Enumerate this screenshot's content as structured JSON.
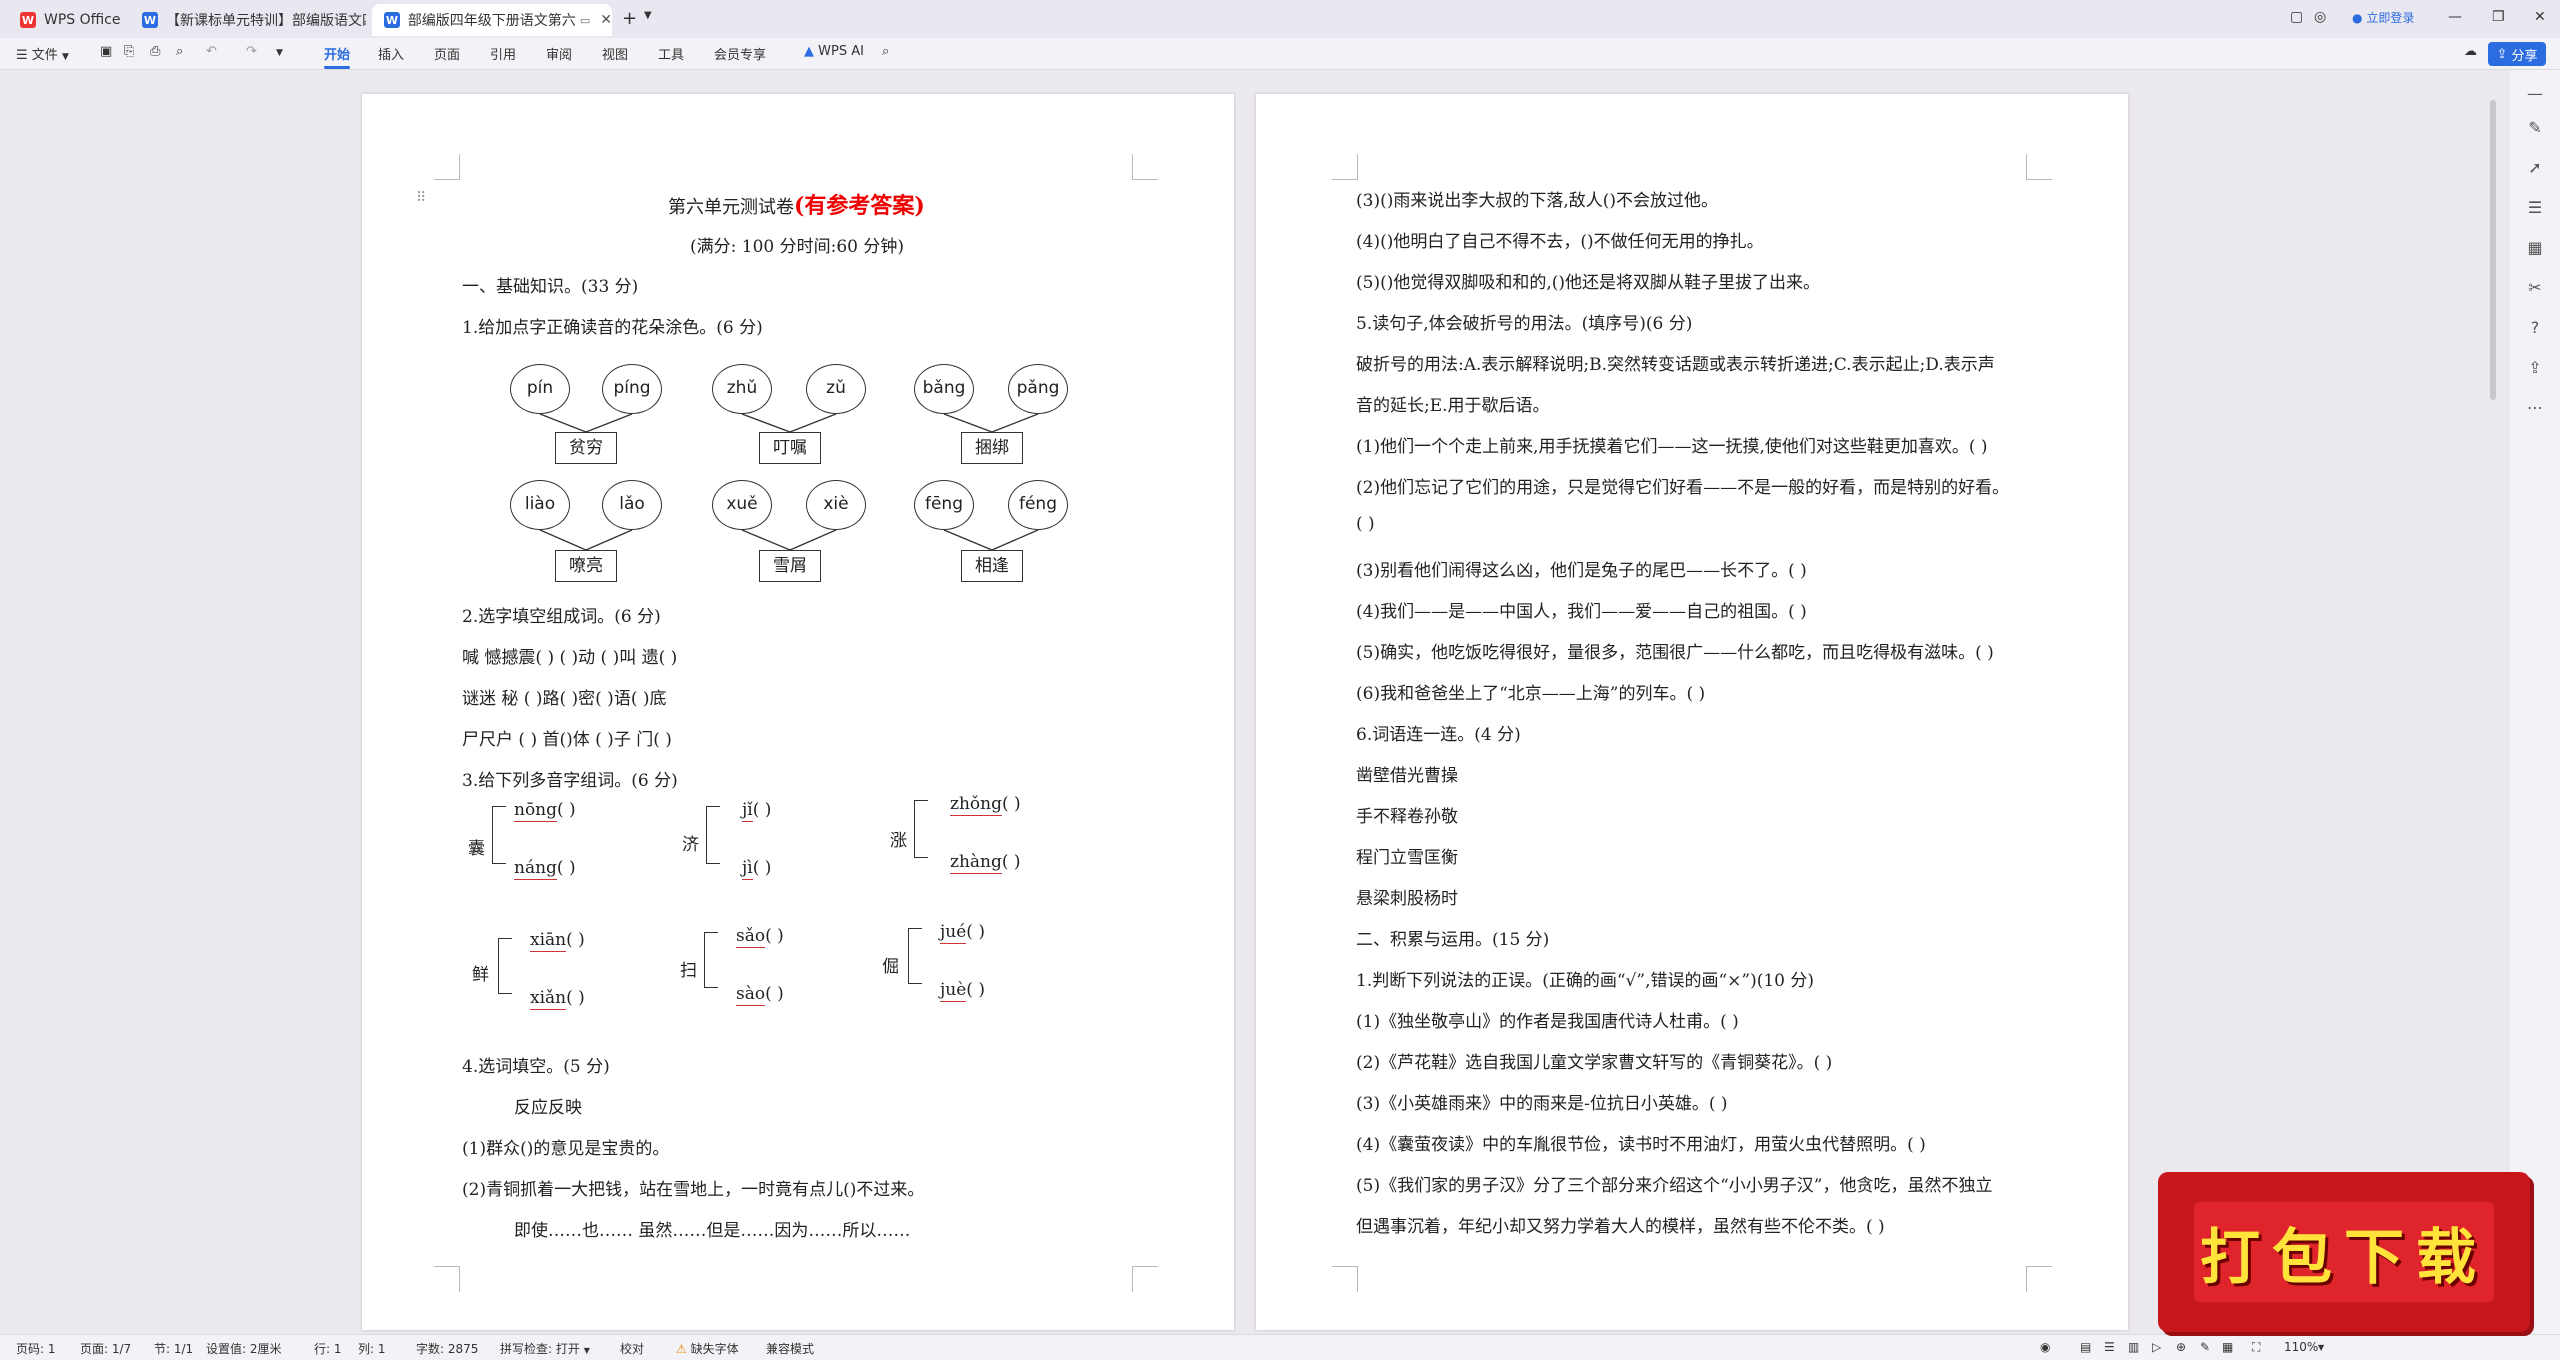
{
  "tabs": [
    {
      "label": "WPS Office",
      "icon": "wps-logo-icon"
    },
    {
      "label": "【新课标单元特训】部编版语文四年",
      "icon": "word-doc-icon"
    },
    {
      "label": "部编版四年级下册语文第六单",
      "icon": "word-doc-icon"
    }
  ],
  "window": {
    "login": "立即登录"
  },
  "menu": {
    "file": "文件",
    "tabs": [
      "开始",
      "插入",
      "页面",
      "引用",
      "审阅",
      "视图",
      "工具",
      "会员专享"
    ],
    "ai": "WPS AI",
    "share": "分享"
  },
  "page1": {
    "title_a": "第六单元测试卷",
    "title_b": "(有参考答案)",
    "subtitle": "(满分: 100 分时间:60 分钟)",
    "s1": "一、基础知识。(33 分)",
    "q1": "1.给加点字正确读音的花朵涂色。(6 分)",
    "flowers": [
      {
        "a": "pín",
        "b": "píng",
        "word": "贫穷"
      },
      {
        "a": "zhǔ",
        "b": "zǔ",
        "word": "叮嘱"
      },
      {
        "a": "bǎng",
        "b": "pǎng",
        "word": "捆绑"
      },
      {
        "a": "liào",
        "b": "lǎo",
        "word": "嘹亮"
      },
      {
        "a": "xuě",
        "b": "xiè",
        "word": "雪屑"
      },
      {
        "a": "fēng",
        "b": "féng",
        "word": "相逢"
      }
    ],
    "q2": "2.选字填空组成词。(6 分)",
    "q2_lines": [
      "喊  憾撼震(  )   (  )动  (  )叫  遗(  )",
      "谜迷  秘  (  )路(  )密(  )语(  )底",
      "尸尺户  (  )  首()体  (  )子 门(  )"
    ],
    "q3": "3.给下列多音字组词。(6 分)",
    "poly": [
      {
        "char": "囊",
        "r1": "nōng",
        "r2": "náng"
      },
      {
        "char": "济",
        "r1": "jǐ",
        "r2": "jì"
      },
      {
        "char": "涨",
        "r1": "zhǒng",
        "r2": "zhàng"
      },
      {
        "char": "鲜",
        "r1": "xiān",
        "r2": "xiǎn"
      },
      {
        "char": "扫",
        "r1": "sǎo",
        "r2": "sào"
      },
      {
        "char": "倔",
        "r1": "jué",
        "r2": "juè"
      }
    ],
    "paren": "(  )",
    "q4": "4.选词填空。(5 分)",
    "q4_words": "反应反映",
    "q4_1": "(1)群众()的意见是宝贵的。",
    "q4_2": "(2)青铜抓着一大把钱，站在雪地上，一时竟有点儿()不过来。",
    "q4_3": "即使……也……  虽然……但是……因为……所以……"
  },
  "page2": {
    "lines": [
      "(3)()雨来说出李大叔的下落,敌人()不会放过他。",
      "(4)()他明白了自己不得不去，()不做任何无用的挣扎。",
      "(5)()他觉得双脚吸和和的,()他还是将双脚从鞋子里拔了出来。",
      "5.读句子,体会破折号的用法。(填序号)(6 分)",
      "破折号的用法:A.表示解释说明;B.突然转变话题或表示转折递进;C.表示起止;D.表示声",
      "音的延长;E.用于歇后语。",
      "(1)他们一个个走上前来,用手抚摸着它们——这一抚摸,使他们对这些鞋更加喜欢。(  )",
      "(2)他们忘记了它们的用途，只是觉得它们好看——不是一般的好看，而是特别的好看。",
      "(  )",
      "(3)别看他们闹得这么凶，他们是兔子的尾巴——长不了。(  )",
      "(4)我们——是——中国人，我们——爱——自己的祖国。(  )",
      "(5)确实，他吃饭吃得很好，量很多，范围很广——什么都吃，而且吃得极有滋味。(  )",
      "(6)我和爸爸坐上了“北京——上海”的列车。(  )",
      "6.词语连一连。(4 分)",
      "凿壁借光曹操",
      "手不释卷孙敬",
      "程门立雪匡衡",
      "悬梁刺股杨时",
      "二、积累与运用。(15 分)",
      "1.判断下列说法的正误。(正确的画“√”,错误的画“×”)(10 分)",
      "(1)《独坐敬亭山》的作者是我国唐代诗人杜甫。(  )",
      "(2)《芦花鞋》选自我国儿童文学家曹文轩写的《青铜葵花》。(  )",
      "(3)《小英雄雨来》中的雨来是-位抗日小英雄。(  )",
      "(4)《囊萤夜读》中的车胤很节俭，读书时不用油灯，用萤火虫代替照明。(  )",
      "(5)《我们家的男子汉》分了三个部分来介绍这个“小小男子汉”，他贪吃，虽然不独立",
      "但遇事沉着，年纪小却又努力学着大人的模样，虽然有些不伦不类。(  )"
    ]
  },
  "status": {
    "page_code": "页码: 1",
    "page_count": "页面: 1/7",
    "section": "节: 1/1",
    "setting": "设置值: 2厘米",
    "row": "行: 1",
    "col": "列: 1",
    "words": "字数: 2875",
    "spell": "拼写检查: 打开",
    "proof": "校对",
    "missing_font": "缺失字体",
    "compat": "兼容模式",
    "zoom": "110%"
  },
  "promo": {
    "text": "打包下载"
  }
}
